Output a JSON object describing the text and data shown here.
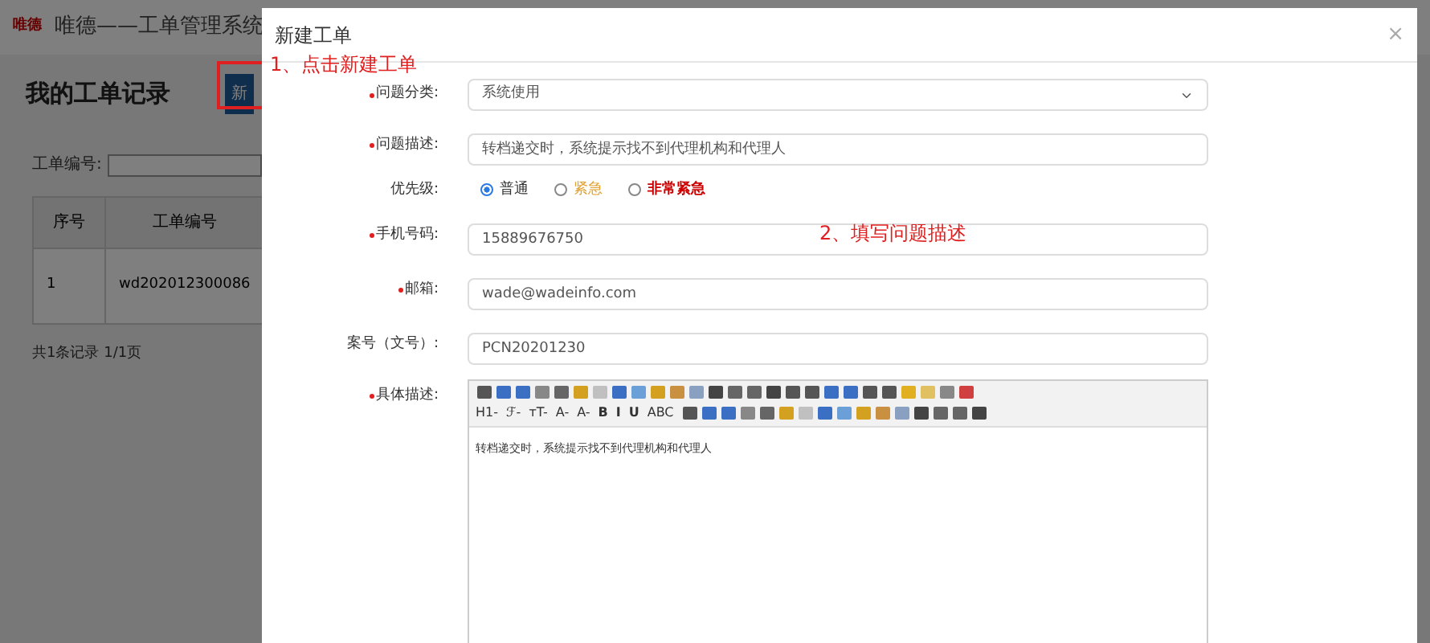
{
  "background_page": {
    "logo_text": "唯德",
    "app_title": "唯德——工单管理系统",
    "page_title": "我的工单记录",
    "new_button": "新",
    "search_label": "工单编号:",
    "table": {
      "columns": [
        "序号",
        "工单编号"
      ],
      "rows": [
        [
          "1",
          "wd202012300086"
        ]
      ]
    },
    "pager": "共1条记录 1/1页"
  },
  "dialog": {
    "title": "新建工单",
    "close": "×",
    "fields": [
      {
        "kind": "select",
        "label": "问题分类:",
        "required": true,
        "value": "系统使用"
      },
      {
        "kind": "text",
        "label": "问题描述:",
        "required": true,
        "value": "转档递交时，系统提示找不到代理机构和代理人"
      },
      {
        "kind": "radio",
        "label": "优先级:",
        "required": false,
        "options": [
          {
            "label": "普通",
            "selected": true,
            "color": "#333333"
          },
          {
            "label": "紧急",
            "selected": false,
            "color": "#e0a030"
          },
          {
            "label": "非常紧急",
            "selected": false,
            "color": "#cc0000"
          }
        ]
      },
      {
        "kind": "text",
        "label": "手机号码:",
        "required": true,
        "value": "15889676750"
      },
      {
        "kind": "text",
        "label": "邮箱:",
        "required": true,
        "value": "wade@wadeinfo.com"
      },
      {
        "kind": "text",
        "label": "案号（文号）:",
        "required": false,
        "value": "PCN20201230"
      },
      {
        "kind": "editor",
        "label": "具体描述:",
        "required": true,
        "value": "转档递交时，系统提示找不到代理机构和代理人",
        "toolbar_text": [
          "H1-",
          "ℱ-",
          "тT-",
          "A-",
          "A-",
          "B",
          "I",
          "U",
          "ABC"
        ]
      }
    ]
  },
  "annotations": [
    "1、点击新建工单",
    "2、填写问题描述"
  ]
}
